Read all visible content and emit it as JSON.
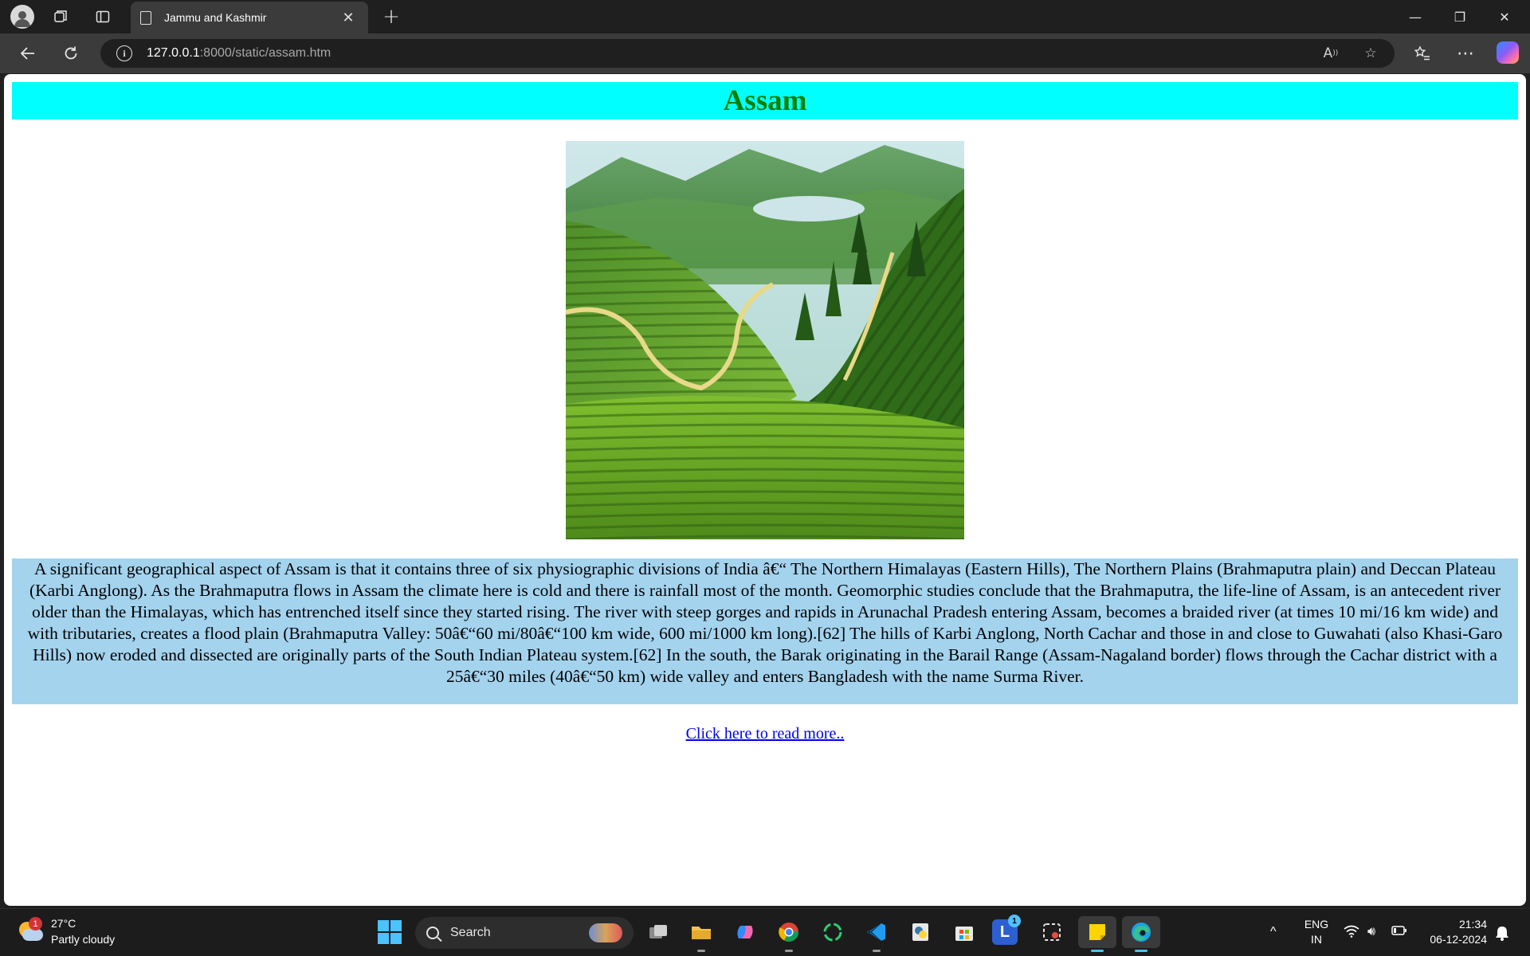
{
  "browser": {
    "tab_title": "Jammu and Kashmir",
    "url_host": "127.0.0.1",
    "url_rest": ":8000/static/assam.htm"
  },
  "page": {
    "heading": "Assam",
    "image_alt": "Terraced tea plantation hills of Assam with a lake in the valley",
    "paragraph": "A significant geographical aspect of Assam is that it contains three of six physiographic divisions of India â€“ The Northern Himalayas (Eastern Hills), The Northern Plains (Brahmaputra plain) and Deccan Plateau (Karbi Anglong). As the Brahmaputra flows in Assam the climate here is cold and there is rainfall most of the month. Geomorphic studies conclude that the Brahmaputra, the life-line of Assam, is an antecedent river older than the Himalayas, which has entrenched itself since they started rising. The river with steep gorges and rapids in Arunachal Pradesh entering Assam, becomes a braided river (at times 10 mi/16 km wide) and with tributaries, creates a flood plain (Brahmaputra Valley: 50â€“60 mi/80â€“100 km wide, 600 mi/1000 km long).[62] The hills of Karbi Anglong, North Cachar and those in and close to Guwahati (also Khasi-Garo Hills) now eroded and dissected are originally parts of the South Indian Plateau system.[62] In the south, the Barak originating in the Barail Range (Assam-Nagaland border) flows through the Cachar district with a 25â€“30 miles (40â€“50 km) wide valley and enters Bangladesh with the name Surma River.",
    "read_more": "Click here to read more..",
    "colors": {
      "heading_bg": "#00ffff",
      "heading_text": "#008000",
      "paragraph_bg": "#a4d3ee",
      "link": "#0000ee"
    }
  },
  "taskbar": {
    "weather_temp": "27°C",
    "weather_desc": "Partly cloudy",
    "weather_badge": "1",
    "search_label": "Search",
    "lang_line1": "ENG",
    "lang_line2": "IN",
    "time": "21:34",
    "date": "06-12-2024",
    "app_badge": "1",
    "icons": [
      "file-explorer-icon",
      "copilot-icon",
      "chrome-icon",
      "vscode-icon",
      "python-icon",
      "store-icon",
      "sticky-notes-icon",
      "edge-icon"
    ]
  }
}
